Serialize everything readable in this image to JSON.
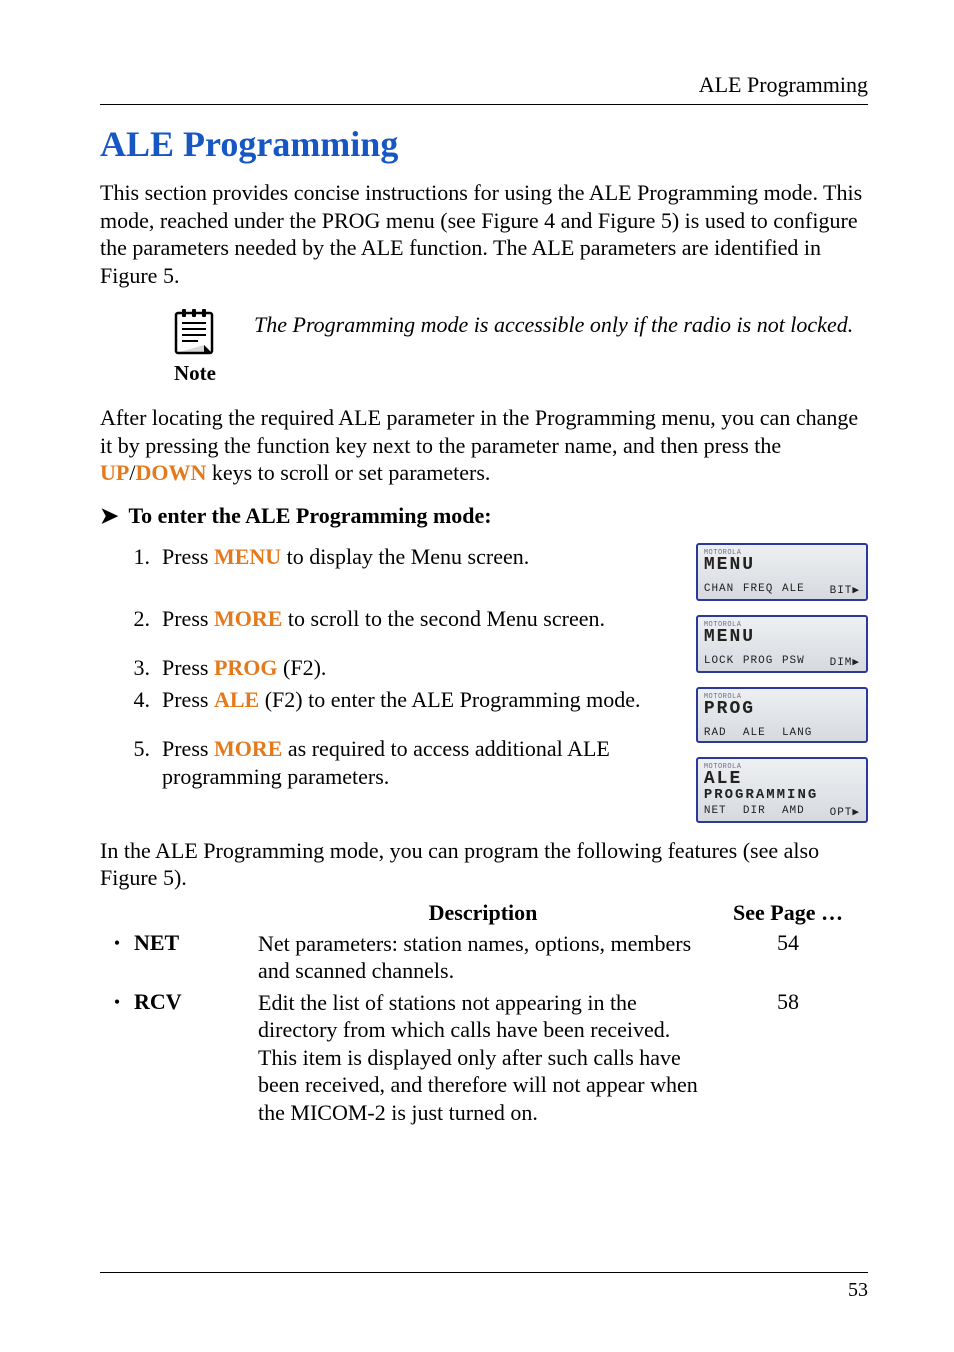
{
  "running_head": "ALE Programming",
  "title": "ALE Programming",
  "intro": "This section provides concise instructions for using the ALE Programming mode. This mode, reached under the PROG menu (see Figure 4 and Figure 5) is used to configure the parameters needed by the ALE function. The ALE parameters are identified in Figure 5.",
  "note": {
    "label": "Note",
    "text": "The Programming mode is accessible only if the radio is not locked."
  },
  "after_note_pre": "After locating the required ALE parameter in the Programming menu, you can change it by pressing the function key next to the parameter name, and then press the ",
  "up_key": "UP",
  "slash": "/",
  "down_key": "DOWN",
  "after_note_post": " keys to scroll or set parameters.",
  "proc_arrow": "➤",
  "proc_title": "To enter the ALE Programming mode:",
  "steps": [
    {
      "num": "1.",
      "pre": "Press ",
      "key": "MENU",
      "post": " to display the Menu screen."
    },
    {
      "num": "2.",
      "pre": "Press ",
      "key": "MORE",
      "post": " to scroll to the second Menu screen."
    },
    {
      "num": "3.",
      "pre": "Press ",
      "key": "PROG",
      "post": " (F2)."
    },
    {
      "num": "4.",
      "pre": "Press ",
      "key": "ALE",
      "post": " (F2) to enter the ALE Programming mode."
    },
    {
      "num": "5.",
      "pre": "Press ",
      "key": "MORE",
      "post": " as required to access additional ALE programming parameters."
    }
  ],
  "screens": [
    {
      "brand": "MOTOROLA",
      "line1": "MENU",
      "line1b": "",
      "soft": [
        "CHAN",
        "FREQ",
        "ALE",
        "BIT▶"
      ]
    },
    {
      "brand": "MOTOROLA",
      "line1": "MENU",
      "line1b": "",
      "soft": [
        "LOCK",
        "PROG",
        "PSW",
        "DIM▶"
      ]
    },
    {
      "brand": "MOTOROLA",
      "line1": "PROG",
      "line1b": "",
      "soft": [
        "RAD",
        "ALE",
        "LANG",
        ""
      ]
    },
    {
      "brand": "MOTOROLA",
      "line1": "ALE",
      "line1b": "PROGRAMMING",
      "soft": [
        "NET",
        "DIR",
        "AMD",
        "OPT▶"
      ]
    }
  ],
  "features_intro": "In the ALE Programming mode, you can program the following features (see also Figure 5).",
  "feat_head": {
    "desc": "Description",
    "page": "See Page …"
  },
  "features": [
    {
      "name": "NET",
      "desc": "Net parameters: station names, options, members and scanned channels.",
      "page": "54"
    },
    {
      "name": "RCV",
      "desc": "Edit the list of stations not appearing in the directory from which calls have been received. This item is displayed only after such calls have been received, and therefore will not appear when the MICOM-2 is just turned on.",
      "page": "58"
    }
  ],
  "bullet_glyph": "•",
  "page_number": "53"
}
